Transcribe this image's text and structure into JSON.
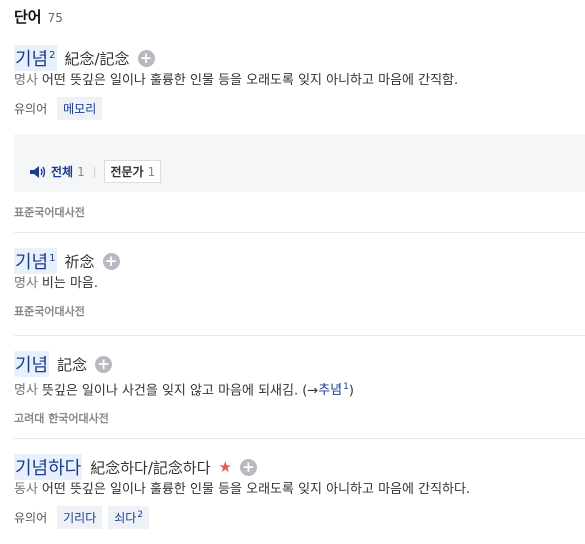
{
  "section": {
    "title": "단어",
    "count": "75"
  },
  "entries": [
    {
      "word": "기념",
      "sup": "2",
      "hanja": "紀念/記念",
      "pos": "명사",
      "definition": "어떤 뜻깊은 일이나 훌륭한 인물 등을 오래도록 잊지 아니하고 마음에 간직함.",
      "syn_label": "유의어",
      "synonyms": [
        {
          "text": "메모리",
          "sup": ""
        }
      ],
      "audio": {
        "all_label": "전체",
        "all_count": "1",
        "expert_label": "전문가",
        "expert_count": "1"
      },
      "source": "표준국어대사전"
    },
    {
      "word": "기념",
      "sup": "1",
      "hanja": "祈念",
      "pos": "명사",
      "definition": "비는 마음.",
      "source": "표준국어대사전"
    },
    {
      "word": "기념",
      "sup": "",
      "hanja": "記念",
      "pos": "명사",
      "definition": "뜻깊은 일이나 사건을 잊지 않고 마음에 되새김. (→",
      "link_text": "추념",
      "link_sup": "1",
      "definition_end": ")",
      "source": "고려대 한국어대사전"
    },
    {
      "word": "기념하다",
      "sup": "",
      "hanja": "紀念하다/記念하다",
      "pos": "동사",
      "definition": "어떤 뜻깊은 일이나 훌륭한 인물 등을 오래도록 잊지 아니하고 마음에 간직하다.",
      "syn_label": "유의어",
      "synonyms": [
        {
          "text": "기리다",
          "sup": ""
        },
        {
          "text": "쇠다",
          "sup": "2"
        }
      ]
    }
  ],
  "icons": {
    "plus": "plus-circle-icon",
    "star": "star-icon",
    "speaker": "speaker-icon"
  },
  "colors": {
    "word": "#1a3d8f",
    "highlight": "#e7f0fb",
    "star": "#e85a4f"
  },
  "glyphs": {
    "plus": "+",
    "star": "★",
    "separator": "|"
  }
}
